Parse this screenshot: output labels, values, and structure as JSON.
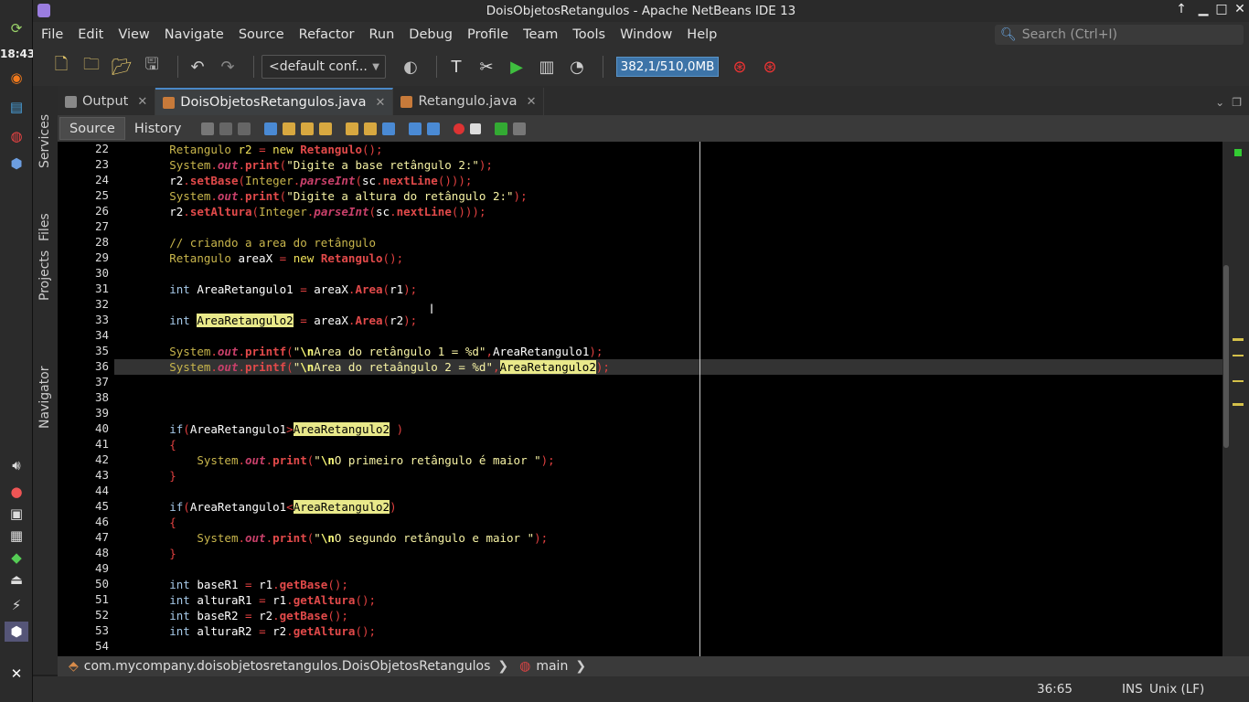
{
  "system": {
    "clock": "18:43"
  },
  "window": {
    "title": "DoisObjetosRetangulos - Apache NetBeans IDE 13"
  },
  "menu": [
    "File",
    "Edit",
    "View",
    "Navigate",
    "Source",
    "Refactor",
    "Run",
    "Debug",
    "Profile",
    "Team",
    "Tools",
    "Window",
    "Help"
  ],
  "search": {
    "placeholder": "Search (Ctrl+I)"
  },
  "toolbar": {
    "config": "<default conf...",
    "memory": "382,1/510,0MB"
  },
  "sidebar": {
    "services": "Services",
    "files": "Files",
    "projects": "Projects",
    "navigator": "Navigator"
  },
  "tabs": [
    {
      "label": "Output"
    },
    {
      "label": "DoisObjetosRetangulos.java"
    },
    {
      "label": "Retangulo.java"
    }
  ],
  "editor_tabs": {
    "source": "Source",
    "history": "History"
  },
  "line_numbers": [
    "22",
    "23",
    "24",
    "25",
    "26",
    "27",
    "28",
    "29",
    "30",
    "31",
    "32",
    "33",
    "34",
    "35",
    "36",
    "37",
    "38",
    "39",
    "40",
    "41",
    "42",
    "43",
    "44",
    "45",
    "46",
    "47",
    "48",
    "49",
    "50",
    "51",
    "52",
    "53",
    "54"
  ],
  "code": {
    "l22": {
      "a": "Retangulo",
      "b": " r2 ",
      "c": "=",
      "d": " new ",
      "e": "Retangulo",
      "f": "();"
    },
    "l23": {
      "a": "System",
      "b": ".",
      "c": "out",
      "d": ".",
      "e": "print",
      "f": "(",
      "g": "\"Digite a base retângulo 2:\"",
      "h": ");"
    },
    "l24": {
      "a": "r2",
      "b": ".",
      "c": "setBase",
      "d": "(",
      "e": "Integer",
      "f": ".",
      "g": "parseInt",
      "h": "(",
      "i": "sc",
      "j": ".",
      "k": "nextLine",
      "l": "()));"
    },
    "l25": {
      "a": "System",
      "b": ".",
      "c": "out",
      "d": ".",
      "e": "print",
      "f": "(",
      "g": "\"Digite a altura do retângulo 2:\"",
      "h": ");"
    },
    "l26": {
      "a": "r2",
      "b": ".",
      "c": "setAltura",
      "d": "(",
      "e": "Integer",
      "f": ".",
      "g": "parseInt",
      "h": "(",
      "i": "sc",
      "j": ".",
      "k": "nextLine",
      "l": "()));"
    },
    "l28": {
      "a": "// criando a area do retângulo"
    },
    "l29": {
      "a": "Retangulo",
      "b": " areaX ",
      "c": "=",
      "d": " new ",
      "e": "Retangulo",
      "f": "();"
    },
    "l31": {
      "a": "int",
      "b": " AreaRetangulo1 ",
      "c": "=",
      "d": " areaX",
      "e": ".",
      "f": "Area",
      "g": "(",
      "h": "r1",
      "i": ");"
    },
    "l33": {
      "a": "int",
      "b": " ",
      "c": "AreaRetangulo2",
      "d": " ",
      "e": "=",
      "f": " areaX",
      "g": ".",
      "h": "Area",
      "i": "(",
      "j": "r2",
      "k": ");"
    },
    "l35": {
      "a": "System",
      "b": ".",
      "c": "out",
      "d": ".",
      "e": "printf",
      "f": "(",
      "g": "\"",
      "h": "\\n",
      "i": "Area do retângulo 1 = %d\"",
      "j": ",",
      "k": "AreaRetangulo1",
      "l": ");"
    },
    "l36": {
      "a": "System",
      "b": ".",
      "c": "out",
      "d": ".",
      "e": "printf",
      "f": "(",
      "g": "\"",
      "h": "\\n",
      "i": "Area do retaângulo 2 = %d\"",
      "j": ",",
      "k": "AreaRetangulo2",
      "l": ");"
    },
    "l40": {
      "a": "if",
      "b": "(",
      "c": "AreaRetangulo1",
      "d": ">",
      "e": "AreaRetangulo2",
      "f": " )"
    },
    "l41": {
      "a": "{"
    },
    "l42": {
      "a": "System",
      "b": ".",
      "c": "out",
      "d": ".",
      "e": "print",
      "f": "(",
      "g": "\"",
      "h": "\\n",
      "i": "O primeiro retângulo é maior \"",
      "j": ");"
    },
    "l43": {
      "a": "}"
    },
    "l45": {
      "a": "if",
      "b": "(",
      "c": "AreaRetangulo1",
      "d": "<",
      "e": "AreaRetangulo2",
      "f": ")"
    },
    "l46": {
      "a": "{"
    },
    "l47": {
      "a": "System",
      "b": ".",
      "c": "out",
      "d": ".",
      "e": "print",
      "f": "(",
      "g": "\"",
      "h": "\\n",
      "i": "O segundo retângulo e maior \"",
      "j": ");"
    },
    "l48": {
      "a": "}"
    },
    "l50": {
      "a": "int",
      "b": " baseR1 ",
      "c": "=",
      "d": " r1",
      "e": ".",
      "f": "getBase",
      "g": "();"
    },
    "l51": {
      "a": "int",
      "b": " alturaR1 ",
      "c": "=",
      "d": " r1",
      "e": ".",
      "f": "getAltura",
      "g": "();"
    },
    "l52": {
      "a": "int",
      "b": " baseR2 ",
      "c": "=",
      "d": " r2",
      "e": ".",
      "f": "getBase",
      "g": "();"
    },
    "l53": {
      "a": "int",
      "b": " alturaR2 ",
      "c": "=",
      "d": " r2",
      "e": ".",
      "f": "getAltura",
      "g": "();"
    }
  },
  "breadcrumb": {
    "package": "com.mycompany.doisobjetosretangulos.DoisObjetosRetangulos",
    "method": "main"
  },
  "status": {
    "position": "36:65",
    "mode": "INS",
    "eol": "Unix (LF)"
  }
}
